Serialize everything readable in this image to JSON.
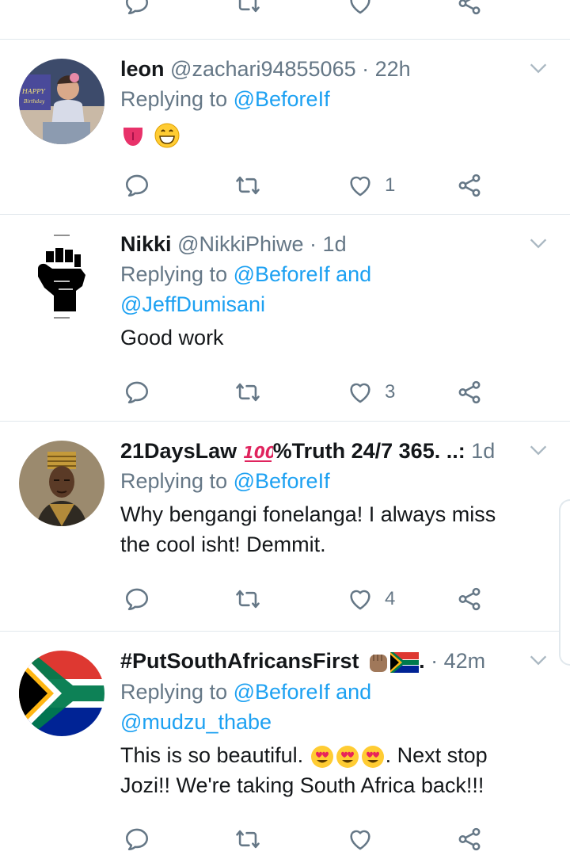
{
  "tweets": [
    {
      "name": "leon",
      "handle": "@zachari94855065",
      "time": "22h",
      "reply_prefix": "Replying to",
      "reply_mention1": "@BeforeIf",
      "reply_joiner": "",
      "reply_mention2": "",
      "body": "",
      "likes": "1",
      "avatar_icon": "baby-photo-avatar"
    },
    {
      "name": "Nikki",
      "handle": "@NikkiPhiwe",
      "time": "1d",
      "reply_prefix": "Replying to",
      "reply_mention1": "@BeforeIf",
      "reply_joiner": "and",
      "reply_mention2": "@JeffDumisani",
      "body": "Good work",
      "likes": "3",
      "avatar_icon": "raised-fist-avatar"
    },
    {
      "name": "21DaysLaw",
      "name_suffix": "%Truth 24/7 365. ..:",
      "handle": "",
      "time": "1d",
      "reply_prefix": "Replying to",
      "reply_mention1": "@BeforeIf",
      "reply_joiner": "",
      "reply_mention2": "",
      "body_line1": "Why bengangi fonelanga! I always miss",
      "body_line2": "the cool isht! Demmit.",
      "likes": "4",
      "avatar_icon": "portrait-painting-avatar"
    },
    {
      "name": "#PutSouthAfricansFirst",
      "name_suffix": ".",
      "handle": "",
      "time": "42m",
      "reply_prefix": "Replying to",
      "reply_mention1": "@BeforeIf",
      "reply_joiner": "and",
      "reply_mention2": "@mudzu_thabe",
      "body_line1a": "This is so beautiful.",
      "body_line1b": ". Next stop",
      "body_line2": "Jozi!! We're taking South Africa back!!!",
      "likes": "",
      "avatar_icon": "south-africa-flag-avatar"
    }
  ],
  "dot": "·",
  "colors": {
    "accent": "#1da1f2",
    "muted": "#657786",
    "text": "#14171a",
    "divider": "#e1e8ed"
  }
}
